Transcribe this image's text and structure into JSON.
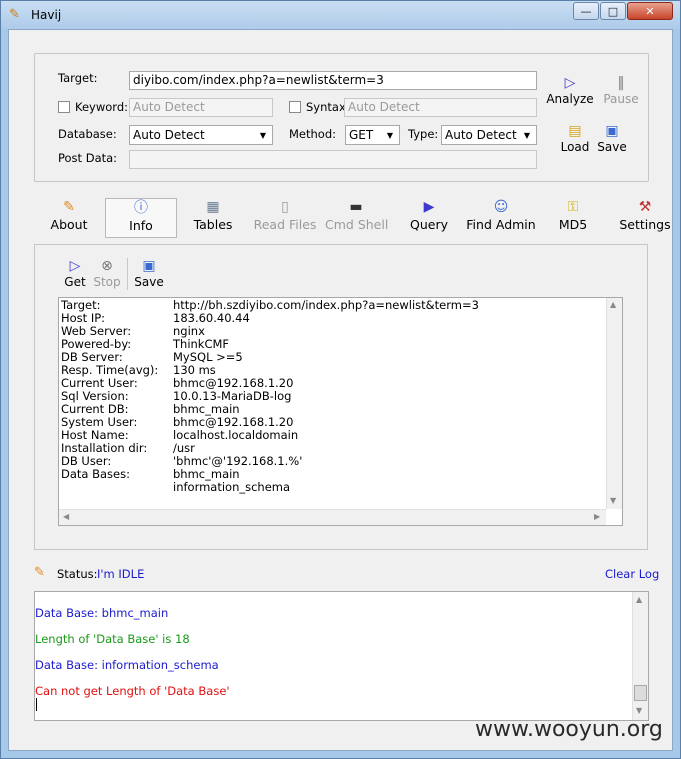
{
  "window": {
    "title": "Havij"
  },
  "form": {
    "target_label": "Target:",
    "target_value": "diyibo.com/index.php?a=newlist&term=3",
    "keyword_label": "Keyword:",
    "keyword_value": "Auto Detect",
    "syntax_label": "Syntax:",
    "syntax_value": "Auto Detect",
    "database_label": "Database:",
    "database_value": "Auto Detect",
    "method_label": "Method:",
    "method_value": "GET",
    "type_label": "Type:",
    "type_value": "Auto Detect",
    "postdata_label": "Post Data:",
    "postdata_value": ""
  },
  "actions": {
    "analyze": "Analyze",
    "pause": "Pause",
    "load": "Load",
    "save": "Save"
  },
  "tabs": [
    {
      "label": "About",
      "icon": "carrot-icon"
    },
    {
      "label": "Info",
      "icon": "info-icon"
    },
    {
      "label": "Tables",
      "icon": "table-icon"
    },
    {
      "label": "Read Files",
      "icon": "file-icon"
    },
    {
      "label": "Cmd Shell",
      "icon": "terminal-icon"
    },
    {
      "label": "Query",
      "icon": "query-icon"
    },
    {
      "label": "Find Admin",
      "icon": "users-icon"
    },
    {
      "label": "MD5",
      "icon": "key-icon"
    },
    {
      "label": "Settings",
      "icon": "tools-icon"
    }
  ],
  "info_toolbar": {
    "get": "Get",
    "stop": "Stop",
    "save": "Save"
  },
  "info": [
    {
      "key": "Target:",
      "value": "http://bh.szdiyibo.com/index.php?a=newlist&term=3"
    },
    {
      "key": "Host IP:",
      "value": "183.60.40.44"
    },
    {
      "key": "Web Server:",
      "value": "nginx"
    },
    {
      "key": "Powered-by:",
      "value": "ThinkCMF"
    },
    {
      "key": "DB Server:",
      "value": "MySQL >=5"
    },
    {
      "key": "Resp. Time(avg):",
      "value": "130 ms"
    },
    {
      "key": "Current User:",
      "value": "bhmc@192.168.1.20"
    },
    {
      "key": "Sql Version:",
      "value": "10.0.13-MariaDB-log"
    },
    {
      "key": "Current DB:",
      "value": "bhmc_main"
    },
    {
      "key": "System User:",
      "value": "bhmc@192.168.1.20"
    },
    {
      "key": "Host Name:",
      "value": "localhost.localdomain"
    },
    {
      "key": "Installation dir:",
      "value": "/usr"
    },
    {
      "key": "DB User:",
      "value": "'bhmc'@'192.168.1.%'"
    },
    {
      "key": "Data Bases:",
      "value": "bhmc_main"
    },
    {
      "key": "",
      "value": "information_schema"
    }
  ],
  "status": {
    "label": "Status:",
    "value": "I'm IDLE",
    "clear_log": "Clear Log"
  },
  "log": [
    {
      "text": "Data Base: bhmc_main",
      "color": "#1a1ad0"
    },
    {
      "text": "Length of 'Data Base' is 18",
      "color": "#1a9a1a"
    },
    {
      "text": "Data Base: information_schema",
      "color": "#1a1ad0"
    },
    {
      "text": "Can not get Length of 'Data Base'",
      "color": "#e01010"
    }
  ],
  "watermark": "www.wooyun.org"
}
